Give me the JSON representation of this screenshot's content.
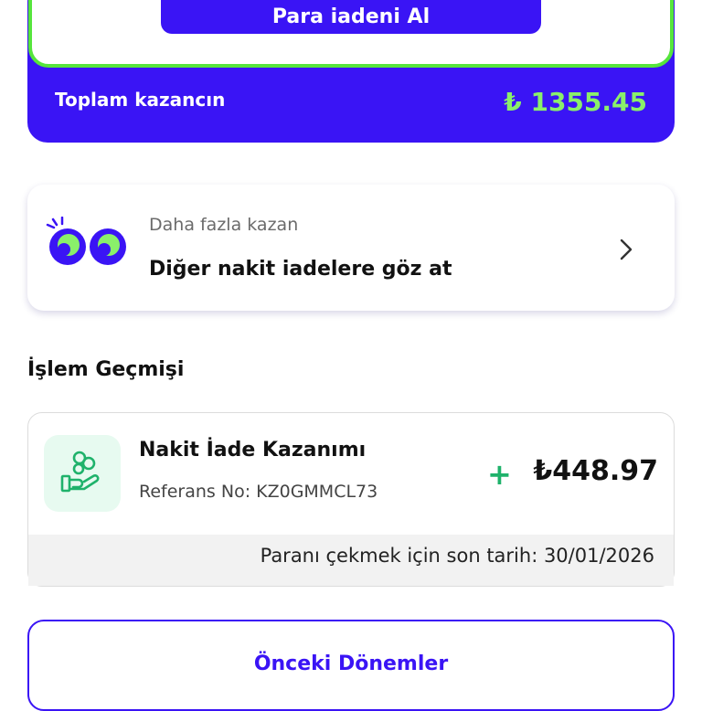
{
  "earnings": {
    "cashout_button_label": "Para iadeni Al",
    "total_label": "Toplam kazancın",
    "total_value": "₺ 1355.45"
  },
  "promo": {
    "subtitle": "Daha fazla kazan",
    "title": "Diğer nakit iadelere göz at",
    "icon": "eyes-icon",
    "chevron": "chevron-right-icon"
  },
  "history": {
    "section_title": "İşlem Geçmişi",
    "transactions": [
      {
        "title": "Nakit İade Kazanımı",
        "reference": "Referans No: KZ0GMMCL73",
        "sign": "+",
        "amount": "₺448.97",
        "deadline": "Paranı çekmek için son tarih: 30/01/2026",
        "icon": "cash-hand-icon"
      }
    ]
  },
  "previous_periods_label": "Önceki Dönemler",
  "colors": {
    "brand": "#3a14f5",
    "accent_green": "#56e53c",
    "amount_green": "#8af06a",
    "plus_green": "#1fb26b"
  }
}
